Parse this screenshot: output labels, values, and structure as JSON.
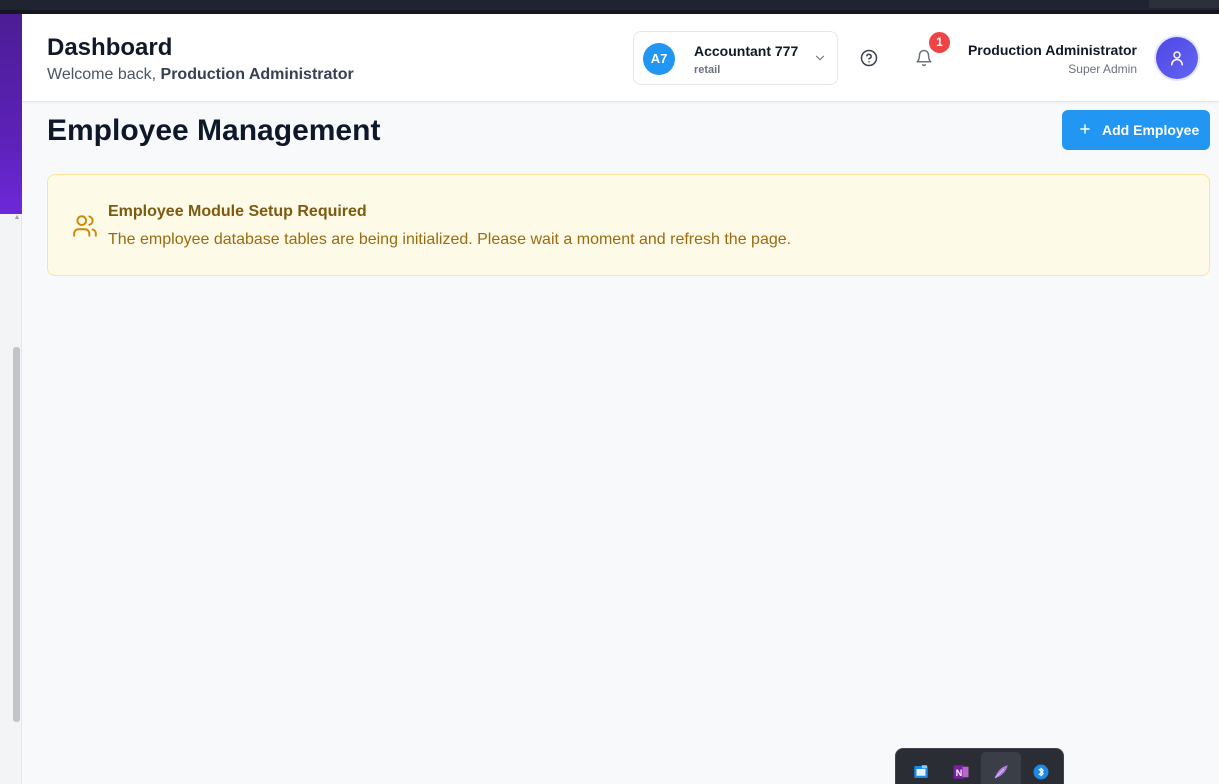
{
  "header": {
    "title": "Dashboard",
    "welcome_prefix": "Welcome back,",
    "welcome_name": "Production Administrator"
  },
  "company_switcher": {
    "initials": "A7",
    "name": "Accountant 777",
    "type": "retail",
    "badge_color": "#2196f3"
  },
  "notifications": {
    "count": "1"
  },
  "user": {
    "name": "Production Administrator",
    "role": "Super Admin"
  },
  "page": {
    "title": "Employee Management",
    "add_button_label": "Add Employee"
  },
  "alert": {
    "title": "Employee Module Setup Required",
    "message": "The employee database tables are being initialized. Please wait a moment and refresh the page.",
    "icon": "users-icon"
  },
  "taskbar": {
    "icons": [
      "window-capture-icon",
      "onenote-icon",
      "feather-app-icon",
      "bluetooth-icon"
    ]
  },
  "colors": {
    "accent": "#2196f3",
    "alert_bg": "#fefae8",
    "alert_border": "#fbe59a",
    "alert_text": "#9a6b10",
    "notification": "#ef4444",
    "sidebar": "#5b21b6"
  }
}
